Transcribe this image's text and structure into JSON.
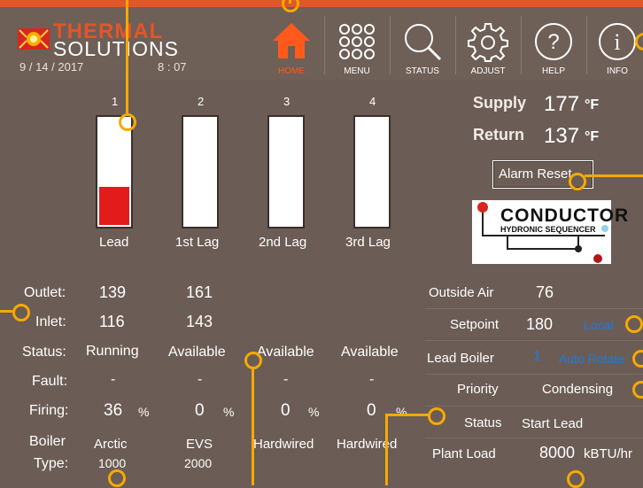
{
  "brand": {
    "line1": "THERMAL",
    "line2": "SOLUTIONS"
  },
  "datetime": {
    "date": "9 / 14 / 2017",
    "time": "8 : 07"
  },
  "nav": [
    {
      "label": "HOME",
      "icon": "home-icon",
      "active": true
    },
    {
      "label": "MENU",
      "icon": "menu-grid-icon"
    },
    {
      "label": "STATUS",
      "icon": "search-icon"
    },
    {
      "label": "ADJUST",
      "icon": "gear-icon"
    },
    {
      "label": "HELP",
      "icon": "help-icon"
    },
    {
      "label": "INFO",
      "icon": "info-icon"
    }
  ],
  "boilers": [
    {
      "number": "1",
      "role": "Lead",
      "outlet": "139",
      "inlet": "116",
      "status": "Running",
      "fault": "-",
      "firing": "36",
      "type_line1": "Arctic",
      "type_line2": "1000",
      "firing_level": 0.36
    },
    {
      "number": "2",
      "role": "1st Lag",
      "outlet": "161",
      "inlet": "143",
      "status": "Available",
      "fault": "-",
      "firing": "0",
      "type_line1": "EVS",
      "type_line2": "2000",
      "firing_level": 0
    },
    {
      "number": "3",
      "role": "2nd Lag",
      "outlet": "",
      "inlet": "",
      "status": "Available",
      "fault": "-",
      "firing": "0",
      "type_line1": "Hardwired",
      "type_line2": "",
      "firing_level": 0
    },
    {
      "number": "4",
      "role": "3rd Lag",
      "outlet": "",
      "inlet": "",
      "status": "Available",
      "fault": "-",
      "firing": "0",
      "type_line1": "Hardwired",
      "type_line2": "",
      "firing_level": 0
    }
  ],
  "row_labels": {
    "outlet": "Outlet:",
    "inlet": "Inlet:",
    "status": "Status:",
    "fault": "Fault:",
    "firing": "Firing:",
    "type1": "Boiler",
    "type2": "Type:",
    "pct": "%"
  },
  "supply": {
    "label": "Supply",
    "value": "177",
    "unit": "°F"
  },
  "return": {
    "label": "Return",
    "value": "137",
    "unit": "°F"
  },
  "alarm_reset": "Alarm Reset",
  "conductor": {
    "title": "CONDUCTOR",
    "subtitle": "HYDRONIC SEQUENCER"
  },
  "plant": {
    "outside_air": {
      "label": "Outside Air",
      "value": "76"
    },
    "setpoint": {
      "label": "Setpoint",
      "value": "180",
      "mode": "Local"
    },
    "lead_boiler": {
      "label": "Lead Boiler",
      "value": "1",
      "mode": "Auto Rotate"
    },
    "priority": {
      "label": "Priority",
      "value": "Condensing"
    },
    "status": {
      "label": "Status",
      "value": "Start Lead"
    },
    "plant_load": {
      "label": "Plant Load",
      "value": "8000",
      "unit": "kBTU/hr"
    }
  },
  "colors": {
    "accent": "#e2562a",
    "background": "#6b5d55",
    "link": "#1f7ae0",
    "callout": "#f7a900",
    "gauge_fill": "#e31b1b"
  }
}
